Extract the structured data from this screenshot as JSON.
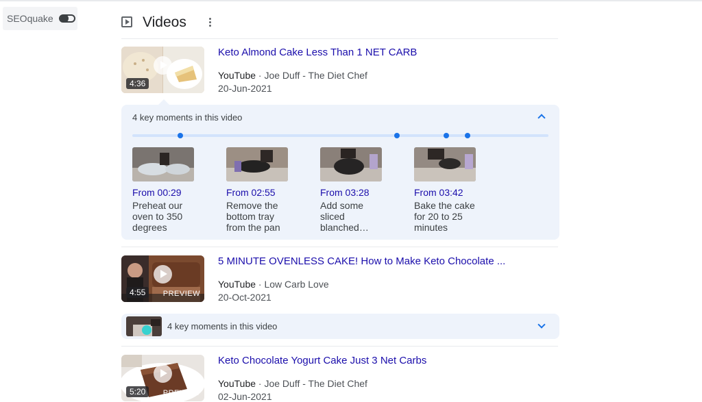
{
  "seoquake": {
    "label": "SEOquake"
  },
  "header": {
    "title": "Videos"
  },
  "videos": [
    {
      "title": "Keto Almond Cake Less Than 1 NET CARB",
      "source": "YouTube",
      "channel": "Joe Duff - The Diet Chef",
      "date": "20-Jun-2021",
      "duration": "4:36"
    },
    {
      "title": "5 MINUTE OVENLESS CAKE! How to Make Keto Chocolate ...",
      "source": "YouTube",
      "channel": "Low Carb Love",
      "date": "20-Oct-2021",
      "duration": "4:55",
      "preview_label": "PREVIEW"
    },
    {
      "title": "Keto Chocolate Yogurt Cake Just 3 Net Carbs",
      "source": "YouTube",
      "channel": "Joe Duff - The Diet Chef",
      "date": "02-Jun-2021",
      "duration": "5:20",
      "preview_label": "PREVIEW"
    }
  ],
  "key_moments": {
    "title": "4 key moments in this video",
    "moments": [
      {
        "time": "From 00:29",
        "text": "Preheat our oven to 350 degrees"
      },
      {
        "time": "From 02:55",
        "text": "Remove the bottom tray from the pan"
      },
      {
        "time": "From 03:28",
        "text": "Add some sliced blanched…"
      },
      {
        "time": "From 03:42",
        "text": "Bake the cake for 20 to 25 minutes"
      }
    ]
  },
  "key_moments_collapsed": {
    "title": "4 key moments in this video"
  },
  "separator": "·"
}
